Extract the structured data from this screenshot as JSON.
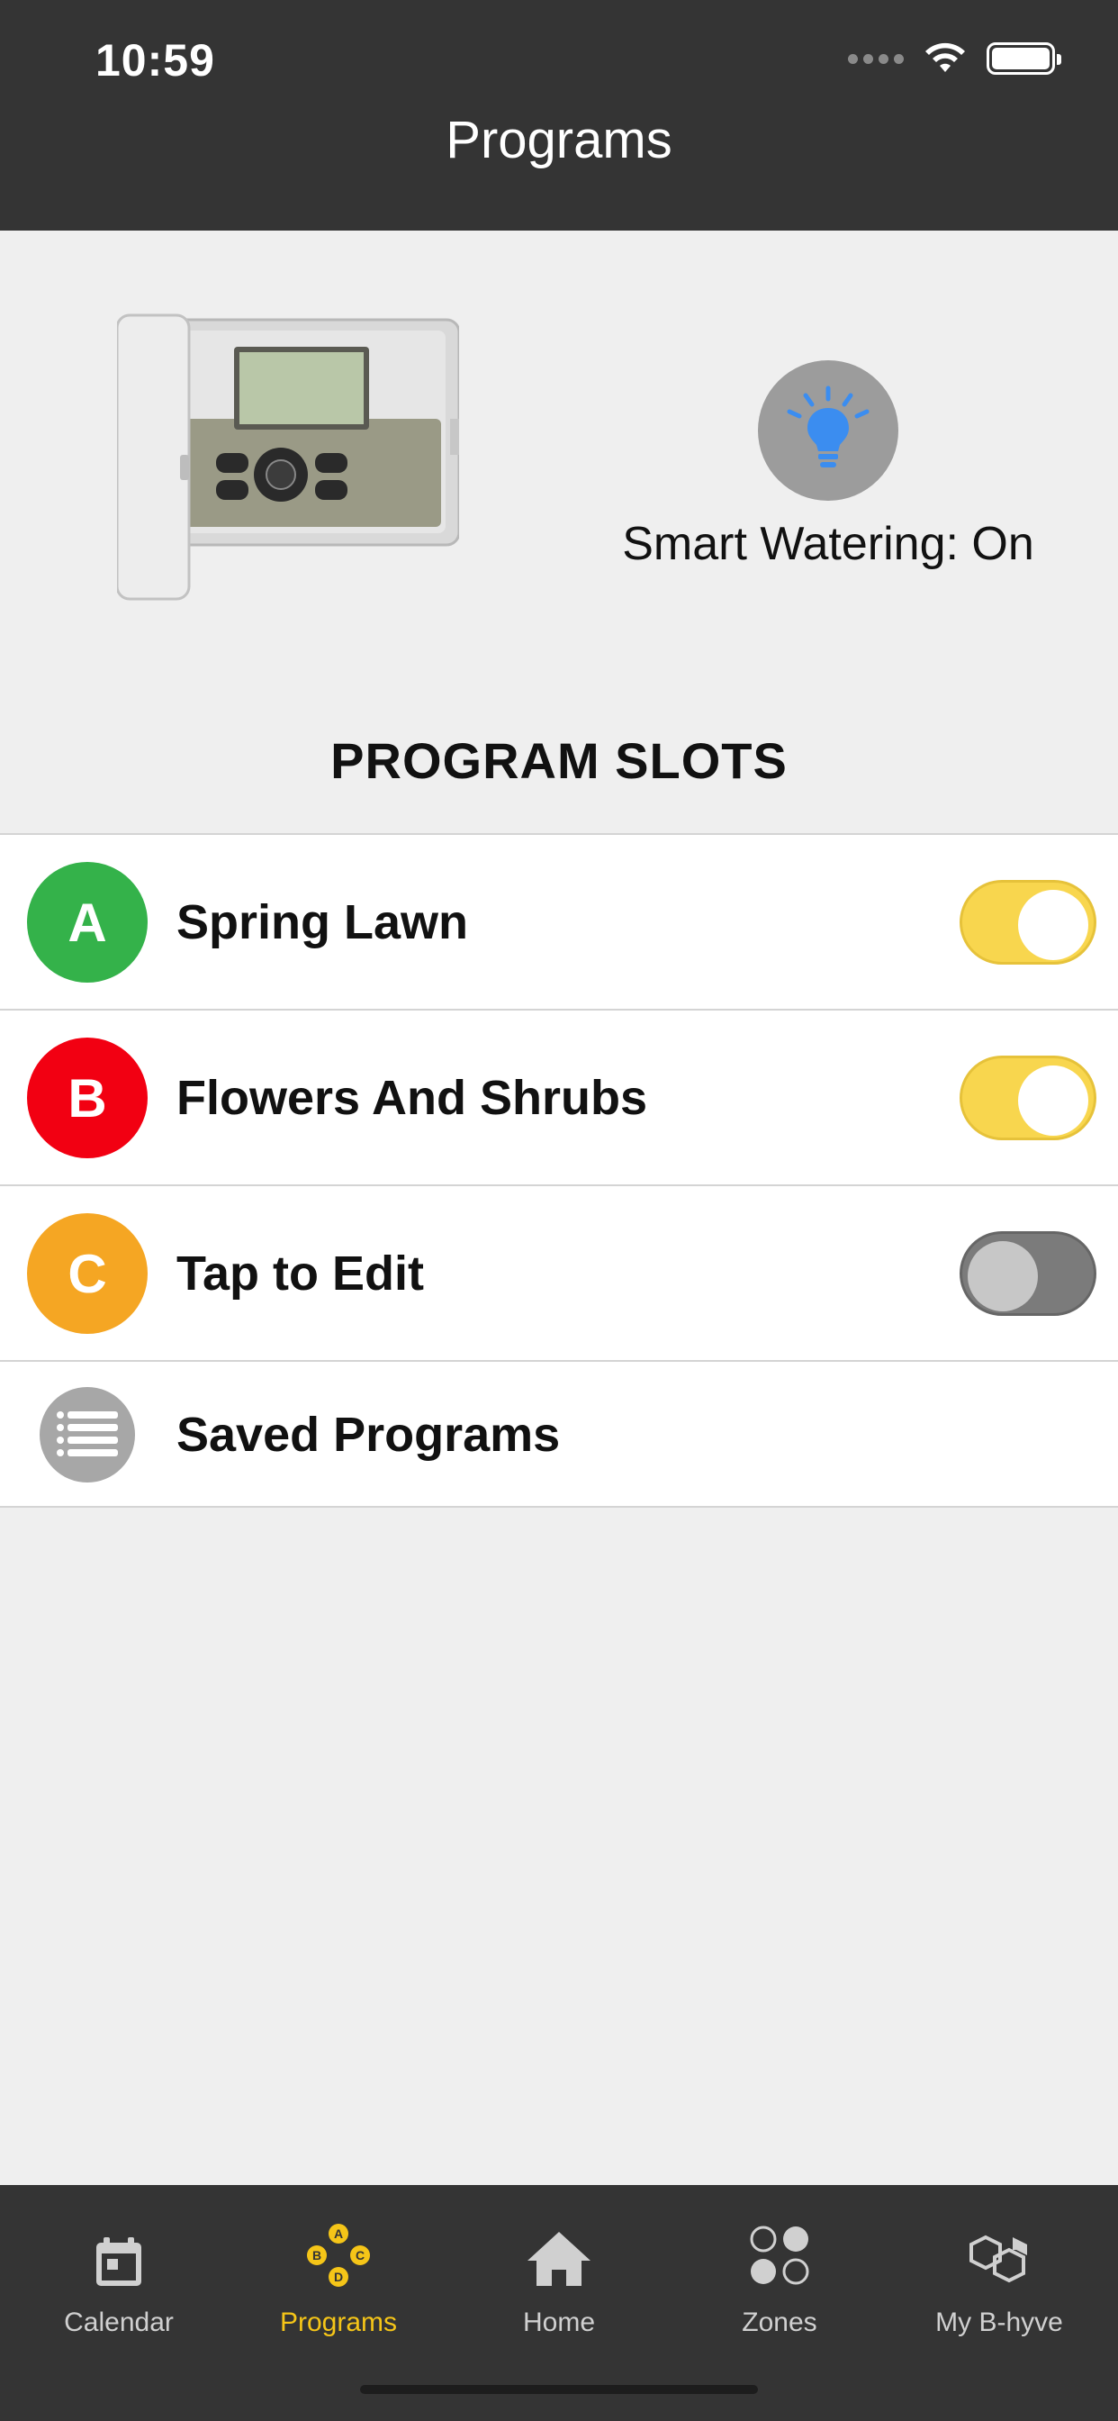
{
  "status_bar": {
    "time": "10:59"
  },
  "header": {
    "title": "Programs"
  },
  "hero": {
    "smart_watering": "Smart Watering: On"
  },
  "section": {
    "title": "PROGRAM SLOTS"
  },
  "programs": [
    {
      "letter": "A",
      "name": "Spring Lawn",
      "color": "#34b24a",
      "enabled": true
    },
    {
      "letter": "B",
      "name": "Flowers And Shrubs",
      "color": "#f20012",
      "enabled": true
    },
    {
      "letter": "C",
      "name": "Tap to Edit",
      "color": "#f5a623",
      "enabled": false
    }
  ],
  "saved": {
    "label": "Saved Programs"
  },
  "tabs": [
    {
      "label": "Calendar",
      "icon": "calendar-icon",
      "active": false
    },
    {
      "label": "Programs",
      "icon": "programs-abcd-icon",
      "active": true
    },
    {
      "label": "Home",
      "icon": "home-icon",
      "active": false
    },
    {
      "label": "Zones",
      "icon": "zones-icon",
      "active": false
    },
    {
      "label": "My B-hyve",
      "icon": "hexagon-icon",
      "active": false
    }
  ],
  "colors": {
    "toggle_on": "#f8d64e",
    "tab_active": "#f5c518",
    "bulb": "#3b8df0"
  }
}
